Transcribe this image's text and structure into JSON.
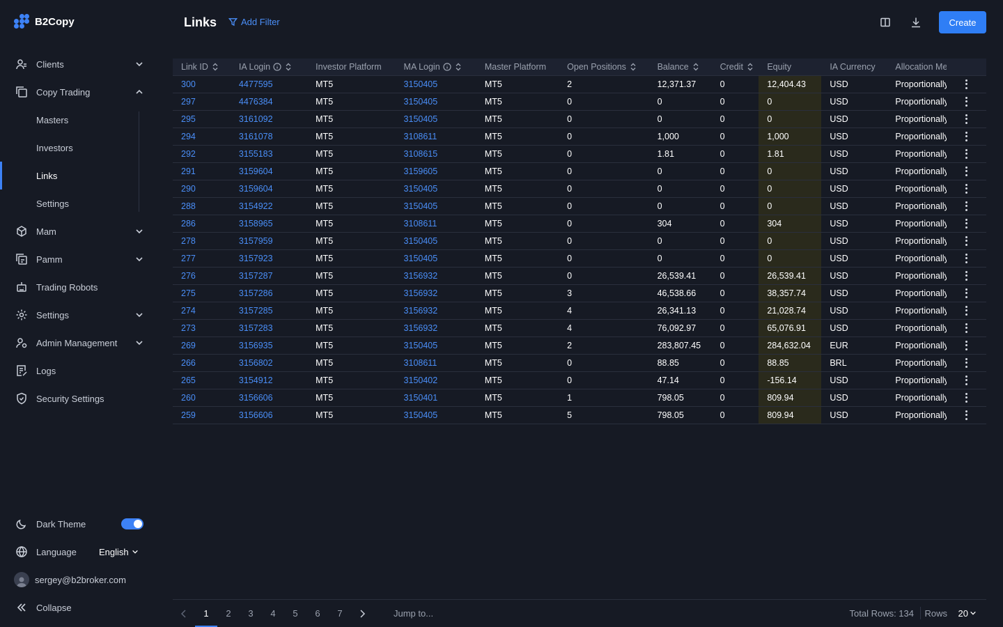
{
  "app": {
    "name": "B2Copy"
  },
  "sidebar": {
    "items": [
      {
        "label": "Clients",
        "icon": "clients-icon",
        "expandable": true
      },
      {
        "label": "Copy Trading",
        "icon": "copy-icon",
        "expandable": true,
        "expanded": true,
        "children": [
          {
            "label": "Masters"
          },
          {
            "label": "Investors"
          },
          {
            "label": "Links",
            "active": true
          },
          {
            "label": "Settings"
          }
        ]
      },
      {
        "label": "Mam",
        "icon": "cube-icon",
        "expandable": true
      },
      {
        "label": "Pamm",
        "icon": "pamm-icon",
        "expandable": true
      },
      {
        "label": "Trading Robots",
        "icon": "robot-icon",
        "expandable": false
      },
      {
        "label": "Settings",
        "icon": "gear-icon",
        "expandable": true
      },
      {
        "label": "Admin Management",
        "icon": "admin-icon",
        "expandable": true
      },
      {
        "label": "Logs",
        "icon": "logs-icon",
        "expandable": false
      },
      {
        "label": "Security Settings",
        "icon": "shield-icon",
        "expandable": false
      }
    ],
    "bottom": {
      "dark_theme_label": "Dark Theme",
      "dark_theme_on": true,
      "language_label": "Language",
      "language_value": "English",
      "user_email": "sergey@b2broker.com",
      "collapse_label": "Collapse"
    }
  },
  "header": {
    "title": "Links",
    "add_filter": "Add Filter",
    "create_label": "Create"
  },
  "table": {
    "columns": [
      "Link ID",
      "IA Login",
      "Investor Platform",
      "MA Login",
      "Master Platform",
      "Open Positions",
      "Balance",
      "Credit",
      "Equity",
      "IA Currency",
      "Allocation Me"
    ],
    "rows": [
      [
        "300",
        "4477595",
        "MT5",
        "3150405",
        "MT5",
        "2",
        "12,371.37",
        "0",
        "12,404.43",
        "USD",
        "Proportionally"
      ],
      [
        "297",
        "4476384",
        "MT5",
        "3150405",
        "MT5",
        "0",
        "0",
        "0",
        "0",
        "USD",
        "Proportionally"
      ],
      [
        "295",
        "3161092",
        "MT5",
        "3150405",
        "MT5",
        "0",
        "0",
        "0",
        "0",
        "USD",
        "Proportionally"
      ],
      [
        "294",
        "3161078",
        "MT5",
        "3108611",
        "MT5",
        "0",
        "1,000",
        "0",
        "1,000",
        "USD",
        "Proportionally"
      ],
      [
        "292",
        "3155183",
        "MT5",
        "3108615",
        "MT5",
        "0",
        "1.81",
        "0",
        "1.81",
        "USD",
        "Proportionally"
      ],
      [
        "291",
        "3159604",
        "MT5",
        "3159605",
        "MT5",
        "0",
        "0",
        "0",
        "0",
        "USD",
        "Proportionally"
      ],
      [
        "290",
        "3159604",
        "MT5",
        "3150405",
        "MT5",
        "0",
        "0",
        "0",
        "0",
        "USD",
        "Proportionally"
      ],
      [
        "288",
        "3154922",
        "MT5",
        "3150405",
        "MT5",
        "0",
        "0",
        "0",
        "0",
        "USD",
        "Proportionally"
      ],
      [
        "286",
        "3158965",
        "MT5",
        "3108611",
        "MT5",
        "0",
        "304",
        "0",
        "304",
        "USD",
        "Proportionally"
      ],
      [
        "278",
        "3157959",
        "MT5",
        "3150405",
        "MT5",
        "0",
        "0",
        "0",
        "0",
        "USD",
        "Proportionally"
      ],
      [
        "277",
        "3157923",
        "MT5",
        "3150405",
        "MT5",
        "0",
        "0",
        "0",
        "0",
        "USD",
        "Proportionally"
      ],
      [
        "276",
        "3157287",
        "MT5",
        "3156932",
        "MT5",
        "0",
        "26,539.41",
        "0",
        "26,539.41",
        "USD",
        "Proportionally"
      ],
      [
        "275",
        "3157286",
        "MT5",
        "3156932",
        "MT5",
        "3",
        "46,538.66",
        "0",
        "38,357.74",
        "USD",
        "Proportionally"
      ],
      [
        "274",
        "3157285",
        "MT5",
        "3156932",
        "MT5",
        "4",
        "26,341.13",
        "0",
        "21,028.74",
        "USD",
        "Proportionally"
      ],
      [
        "273",
        "3157283",
        "MT5",
        "3156932",
        "MT5",
        "4",
        "76,092.97",
        "0",
        "65,076.91",
        "USD",
        "Proportionally"
      ],
      [
        "269",
        "3156935",
        "MT5",
        "3150405",
        "MT5",
        "2",
        "283,807.45",
        "0",
        "284,632.04",
        "EUR",
        "Proportionally"
      ],
      [
        "266",
        "3156802",
        "MT5",
        "3108611",
        "MT5",
        "0",
        "88.85",
        "0",
        "88.85",
        "BRL",
        "Proportionally"
      ],
      [
        "265",
        "3154912",
        "MT5",
        "3150402",
        "MT5",
        "0",
        "47.14",
        "0",
        "-156.14",
        "USD",
        "Proportionally"
      ],
      [
        "260",
        "3156606",
        "MT5",
        "3150401",
        "MT5",
        "1",
        "798.05",
        "0",
        "809.94",
        "USD",
        "Proportionally"
      ],
      [
        "259",
        "3156606",
        "MT5",
        "3150405",
        "MT5",
        "5",
        "798.05",
        "0",
        "809.94",
        "USD",
        "Proportionally"
      ]
    ]
  },
  "pagination": {
    "pages": [
      "1",
      "2",
      "3",
      "4",
      "5",
      "6",
      "7"
    ],
    "current": "1",
    "jump_label": "Jump to...",
    "total_rows": "Total Rows: 134",
    "rows_label": "Rows",
    "rows_value": "20"
  },
  "colors": {
    "accent": "#3d82f6",
    "link": "#4a8ef7",
    "background": "#161a24",
    "equity_bg": "#2a2a1c"
  }
}
